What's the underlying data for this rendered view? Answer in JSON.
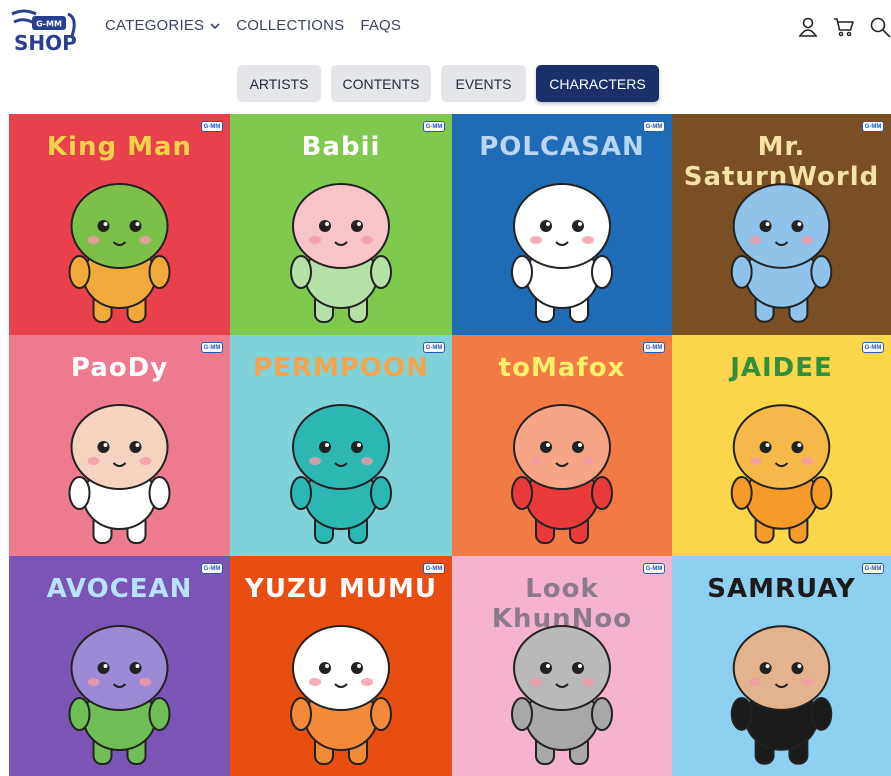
{
  "header": {
    "logo_text": "SHOP",
    "logo_badge": "G-MM",
    "nav": [
      "CATEGORIES",
      "COLLECTIONS",
      "FAQS"
    ],
    "icons": [
      "user-icon",
      "cart-icon",
      "search-icon"
    ]
  },
  "tabs": [
    {
      "label": "ARTISTS",
      "active": false
    },
    {
      "label": "CONTENTS",
      "active": false
    },
    {
      "label": "EVENTS",
      "active": false
    },
    {
      "label": "CHARACTERS",
      "active": true
    }
  ],
  "badge_text": "G-MM",
  "characters": [
    {
      "name": "King Man",
      "bg": "#e8414b",
      "title_color": "#f6d24a",
      "body": "#f2a93b",
      "face": "#7cc04a"
    },
    {
      "name": "Babii",
      "bg": "#7ec94e",
      "title_color": "#ffffff",
      "body": "#b6e0a6",
      "face": "#f8c4c8"
    },
    {
      "name": "POLCASAN",
      "bg": "#1f6bb6",
      "title_color": "#b9d7f5",
      "body": "#ffffff",
      "face": "#ffffff"
    },
    {
      "name": "Mr. SaturnWorld",
      "bg": "#7a4f24",
      "title_color": "#f5e3a6",
      "body": "#8fc3ea",
      "face": "#8fc3ea"
    },
    {
      "name": "PaoDy",
      "bg": "#ee7a90",
      "title_color": "#ffffff",
      "body": "#ffffff",
      "face": "#f6d3c1"
    },
    {
      "name": "PERMPOON",
      "bg": "#7fd3d8",
      "title_color": "#f5a24b",
      "body": "#2cb7b2",
      "face": "#2cb7b2"
    },
    {
      "name": "toMafox",
      "bg": "#f27a45",
      "title_color": "#fff06a",
      "body": "#e93a3a",
      "face": "#f7a685"
    },
    {
      "name": "JAIDEE",
      "bg": "#fbd64a",
      "title_color": "#2f8f3c",
      "body": "#f59b2a",
      "face": "#f7b84a"
    },
    {
      "name": "AVOCEAN",
      "bg": "#7b55b6",
      "title_color": "#b9e2ff",
      "body": "#6fbe56",
      "face": "#9d8ad6"
    },
    {
      "name": "YUZU MUMU",
      "bg": "#e84e12",
      "title_color": "#ffffff",
      "body": "#f28a3a",
      "face": "#ffffff"
    },
    {
      "name": "Look KhunNoo",
      "bg": "#f6b3cf",
      "title_color": "#8a7a8a",
      "body": "#a8a8a8",
      "face": "#b9b9b9"
    },
    {
      "name": "SAMRUAY",
      "bg": "#8ed0f0",
      "title_color": "#1b1b1b",
      "body": "#1b1b1b",
      "face": "#e3b38e"
    }
  ]
}
